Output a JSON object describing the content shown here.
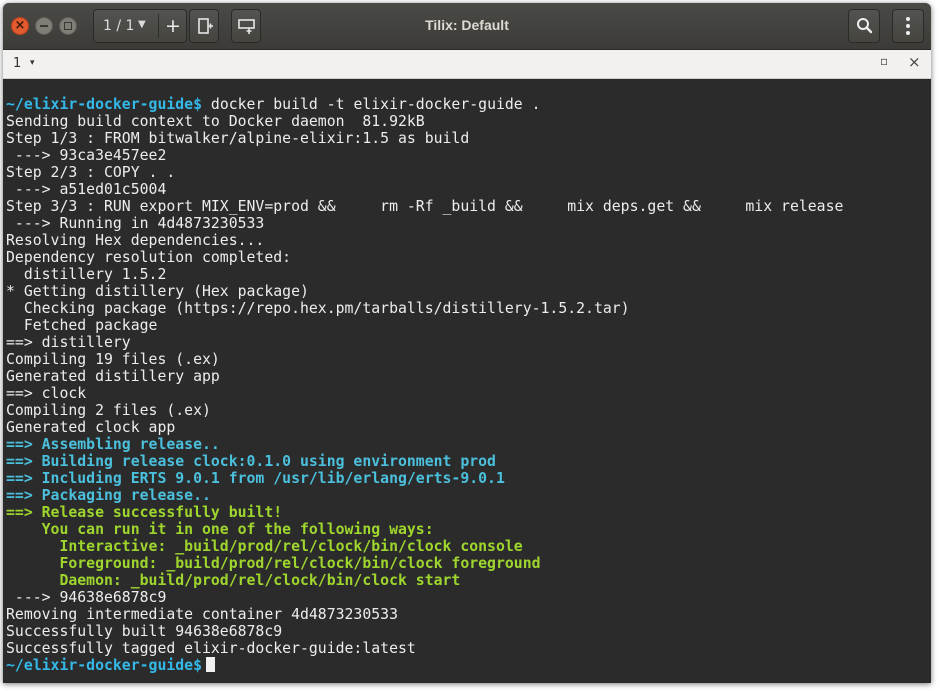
{
  "window": {
    "title": "Tilix: Default",
    "close_glyph": "×"
  },
  "toolbar": {
    "session_counter": "1 / 1",
    "session_dropdown_icon": "chevron-down-icon",
    "add_session_label": "+",
    "add_session_icon": "plus-icon",
    "split_right_icon": "split-right-icon",
    "split_down_icon": "split-down-icon",
    "search_icon": "search-icon",
    "menu_icon": "kebab-menu-icon"
  },
  "session": {
    "title": "1",
    "dropdown_glyph": "▾",
    "maximize_glyph": "▫",
    "close_glyph": "×"
  },
  "terminal": {
    "colors": {
      "background": "#2b2b2b",
      "foreground": "#ededed",
      "prompt": "#34b8e8",
      "mix_cyan": "#4bc0dc",
      "mix_green": "#9fd62e"
    },
    "lines": [
      {
        "prompt": "~/elixir-docker-guide$",
        "text": " docker build -t elixir-docker-guide ."
      },
      {
        "text": "Sending build context to Docker daemon  81.92kB"
      },
      {
        "text": "Step 1/3 : FROM bitwalker/alpine-elixir:1.5 as build"
      },
      {
        "text": " ---> 93ca3e457ee2"
      },
      {
        "text": "Step 2/3 : COPY . ."
      },
      {
        "text": " ---> a51ed01c5004"
      },
      {
        "text": "Step 3/3 : RUN export MIX_ENV=prod &&     rm -Rf _build &&     mix deps.get &&     mix release"
      },
      {
        "text": " ---> Running in 4d4873230533"
      },
      {
        "text": "Resolving Hex dependencies..."
      },
      {
        "text": "Dependency resolution completed:"
      },
      {
        "text": "  distillery 1.5.2"
      },
      {
        "text": "* Getting distillery (Hex package)"
      },
      {
        "text": "  Checking package (https://repo.hex.pm/tarballs/distillery-1.5.2.tar)"
      },
      {
        "text": "  Fetched package"
      },
      {
        "text": "==> distillery"
      },
      {
        "text": "Compiling 19 files (.ex)"
      },
      {
        "text": "Generated distillery app"
      },
      {
        "text": "==> clock"
      },
      {
        "text": "Compiling 2 files (.ex)"
      },
      {
        "text": "Generated clock app"
      },
      {
        "style": "cyan",
        "text": "==> Assembling release.."
      },
      {
        "style": "cyan",
        "text": "==> Building release clock:0.1.0 using environment prod"
      },
      {
        "style": "cyan",
        "text": "==> Including ERTS 9.0.1 from /usr/lib/erlang/erts-9.0.1"
      },
      {
        "style": "cyan",
        "text": "==> Packaging release.."
      },
      {
        "style": "green",
        "text": "==> Release successfully built!"
      },
      {
        "style": "green",
        "text": "    You can run it in one of the following ways:"
      },
      {
        "style": "green",
        "text": "      Interactive: _build/prod/rel/clock/bin/clock console"
      },
      {
        "style": "green",
        "text": "      Foreground: _build/prod/rel/clock/bin/clock foreground"
      },
      {
        "style": "green",
        "text": "      Daemon: _build/prod/rel/clock/bin/clock start"
      },
      {
        "text": " ---> 94638e6878c9"
      },
      {
        "text": "Removing intermediate container 4d4873230533"
      },
      {
        "text": "Successfully built 94638e6878c9"
      },
      {
        "text": "Successfully tagged elixir-docker-guide:latest"
      },
      {
        "prompt": "~/elixir-docker-guide$",
        "text": "",
        "cursor": true
      }
    ]
  }
}
